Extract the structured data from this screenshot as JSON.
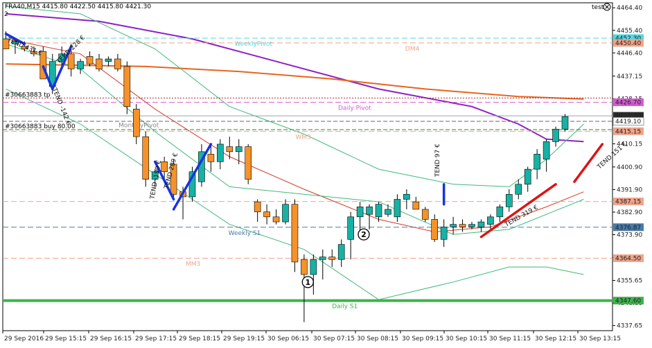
{
  "header": {
    "symbol": "FRA40,M15  4415.80 4422.50 4415.80 4421.30",
    "indicator": "test",
    "corner_digit": "2"
  },
  "colors": {
    "bull": "#17b2a4",
    "bear": "#f5922a",
    "purple": "#8e1fc4",
    "orange": "#e8641e",
    "red": "#d43a2a",
    "green": "#3fb97a",
    "s1": "#3cb44b",
    "cyan": "#4fd8e6",
    "magenta": "#d65ad6",
    "trade": "#b02727",
    "blue_line": "#1733e0",
    "red_line": "#e01212",
    "salmon": "#f0a48a",
    "slate": "#4a7aa8"
  },
  "chart_data": {
    "type": "candlestick",
    "x_ticks": [
      "29 Sep 2016",
      "29 Sep 15:15",
      "29 Sep 16:15",
      "29 Sep 17:15",
      "29 Sep 18:15",
      "29 Sep 19:15",
      "30 Sep 06:15",
      "30 Sep 07:15",
      "30 Sep 08:15",
      "30 Sep 09:15",
      "30 Sep 10:15",
      "30 Sep 11:15",
      "30 Sep 12:15",
      "30 Sep 13:15"
    ],
    "y_ticks": [
      4464.4,
      4455.4,
      4446.4,
      4437.15,
      4428.15,
      4419.1,
      4410.15,
      4400.9,
      4391.9,
      4382.9,
      4373.9,
      4364.65,
      4355.65,
      4346.6,
      4337.65
    ],
    "ylim": [
      4335.6,
      4466.4
    ],
    "candles": [
      {
        "o": 4452,
        "h": 4455,
        "l": 4448,
        "c": 4448
      },
      {
        "o": 4450,
        "h": 4452,
        "l": 4446,
        "c": 4451
      },
      {
        "o": 4449,
        "h": 4451,
        "l": 4447,
        "c": 4448
      },
      {
        "o": 4447,
        "h": 4449,
        "l": 4445,
        "c": 4446
      },
      {
        "o": 4447,
        "h": 4449,
        "l": 4436,
        "c": 4436
      },
      {
        "o": 4433,
        "h": 4446,
        "l": 4430,
        "c": 4443
      },
      {
        "o": 4443,
        "h": 4449,
        "l": 4440,
        "c": 4446
      },
      {
        "o": 4446,
        "h": 4450,
        "l": 4437,
        "c": 4440
      },
      {
        "o": 4440,
        "h": 4444,
        "l": 4438,
        "c": 4443
      },
      {
        "o": 4445,
        "h": 4447,
        "l": 4441,
        "c": 4442
      },
      {
        "o": 4444,
        "h": 4446,
        "l": 4439,
        "c": 4440
      },
      {
        "o": 4443,
        "h": 4445,
        "l": 4441,
        "c": 4444
      },
      {
        "o": 4444,
        "h": 4446,
        "l": 4439,
        "c": 4440
      },
      {
        "o": 4441,
        "h": 4443,
        "l": 4422,
        "c": 4425
      },
      {
        "o": 4424,
        "h": 4426,
        "l": 4410,
        "c": 4413
      },
      {
        "o": 4413,
        "h": 4415,
        "l": 4393,
        "c": 4396
      },
      {
        "o": 4396,
        "h": 4400,
        "l": 4393,
        "c": 4399
      },
      {
        "o": 4403,
        "h": 4405,
        "l": 4396,
        "c": 4399
      },
      {
        "o": 4402,
        "h": 4404,
        "l": 4388,
        "c": 4390
      },
      {
        "o": 4391,
        "h": 4393,
        "l": 4380,
        "c": 4389
      },
      {
        "o": 4389,
        "h": 4401,
        "l": 4387,
        "c": 4399
      },
      {
        "o": 4395,
        "h": 4410,
        "l": 4393,
        "c": 4407
      },
      {
        "o": 4406,
        "h": 4410,
        "l": 4399,
        "c": 4403
      },
      {
        "o": 4403,
        "h": 4412,
        "l": 4400,
        "c": 4410
      },
      {
        "o": 4409,
        "h": 4413,
        "l": 4404,
        "c": 4407
      },
      {
        "o": 4407,
        "h": 4412,
        "l": 4402,
        "c": 4409
      },
      {
        "o": 4409,
        "h": 4410,
        "l": 4394,
        "c": 4396
      },
      {
        "o": 4387,
        "h": 4388,
        "l": 4379,
        "c": 4383
      },
      {
        "o": 4383,
        "h": 4386,
        "l": 4378,
        "c": 4381
      },
      {
        "o": 4381,
        "h": 4384,
        "l": 4378,
        "c": 4379
      },
      {
        "o": 4379,
        "h": 4388,
        "l": 4378,
        "c": 4386
      },
      {
        "o": 4386,
        "h": 4388,
        "l": 4359,
        "c": 4363
      },
      {
        "o": 4364,
        "h": 4366,
        "l": 4339,
        "c": 4358
      },
      {
        "o": 4358,
        "h": 4366,
        "l": 4350,
        "c": 4364
      },
      {
        "o": 4364,
        "h": 4368,
        "l": 4356,
        "c": 4365
      },
      {
        "o": 4365,
        "h": 4368,
        "l": 4361,
        "c": 4364
      },
      {
        "o": 4364,
        "h": 4372,
        "l": 4361,
        "c": 4370
      },
      {
        "o": 4372,
        "h": 4383,
        "l": 4364,
        "c": 4381
      },
      {
        "o": 4381,
        "h": 4387,
        "l": 4375,
        "c": 4385
      },
      {
        "o": 4382,
        "h": 4386,
        "l": 4376,
        "c": 4385
      },
      {
        "o": 4381,
        "h": 4387,
        "l": 4379,
        "c": 4386
      },
      {
        "o": 4382,
        "h": 4386,
        "l": 4381,
        "c": 4384
      },
      {
        "o": 4381,
        "h": 4390,
        "l": 4379,
        "c": 4388
      },
      {
        "o": 4388,
        "h": 4392,
        "l": 4384,
        "c": 4390
      },
      {
        "o": 4387,
        "h": 4389,
        "l": 4384,
        "c": 4384
      },
      {
        "o": 4384,
        "h": 4385,
        "l": 4379,
        "c": 4380
      },
      {
        "o": 4380,
        "h": 4382,
        "l": 4371,
        "c": 4372
      },
      {
        "o": 4372,
        "h": 4380,
        "l": 4369,
        "c": 4377
      },
      {
        "o": 4377,
        "h": 4381,
        "l": 4374,
        "c": 4378
      },
      {
        "o": 4378,
        "h": 4380,
        "l": 4375,
        "c": 4377
      },
      {
        "o": 4377,
        "h": 4379,
        "l": 4376,
        "c": 4378
      },
      {
        "o": 4377,
        "h": 4380,
        "l": 4375,
        "c": 4379
      },
      {
        "o": 4378,
        "h": 4382,
        "l": 4376,
        "c": 4381
      },
      {
        "o": 4381,
        "h": 4386,
        "l": 4379,
        "c": 4385
      },
      {
        "o": 4385,
        "h": 4392,
        "l": 4383,
        "c": 4390
      },
      {
        "o": 4390,
        "h": 4396,
        "l": 4388,
        "c": 4394
      },
      {
        "o": 4394,
        "h": 4401,
        "l": 4391,
        "c": 4400
      },
      {
        "o": 4400,
        "h": 4408,
        "l": 4396,
        "c": 4406
      },
      {
        "o": 4404,
        "h": 4412,
        "l": 4399,
        "c": 4411
      },
      {
        "o": 4411,
        "h": 4417,
        "l": 4409,
        "c": 4416
      },
      {
        "o": 4416,
        "h": 4422,
        "l": 4415,
        "c": 4421
      }
    ],
    "indicator_lines": [
      {
        "name": "purple",
        "color": "#8e1fc4",
        "width": 2,
        "points": [
          [
            0,
            4462
          ],
          [
            10,
            4459
          ],
          [
            20,
            4452
          ],
          [
            30,
            4442
          ],
          [
            40,
            4432
          ],
          [
            50,
            4425
          ],
          [
            55,
            4418
          ],
          [
            58,
            4412
          ],
          [
            62,
            4411
          ]
        ]
      },
      {
        "name": "orange",
        "color": "#e8641e",
        "width": 2,
        "points": [
          [
            0,
            4442
          ],
          [
            15,
            4441
          ],
          [
            25,
            4439
          ],
          [
            35,
            4436
          ],
          [
            45,
            4432
          ],
          [
            55,
            4429
          ],
          [
            62,
            4428
          ]
        ]
      },
      {
        "name": "red",
        "color": "#d43a2a",
        "width": 1,
        "points": [
          [
            0,
            4452
          ],
          [
            8,
            4446
          ],
          [
            16,
            4424
          ],
          [
            24,
            4405
          ],
          [
            32,
            4392
          ],
          [
            40,
            4380
          ],
          [
            46,
            4375
          ],
          [
            52,
            4377
          ],
          [
            58,
            4385
          ],
          [
            62,
            4391
          ]
        ]
      },
      {
        "name": "green-upper",
        "color": "#3fb97a",
        "width": 1,
        "points": [
          [
            0,
            4465
          ],
          [
            8,
            4462
          ],
          [
            16,
            4448
          ],
          [
            24,
            4425
          ],
          [
            32,
            4414
          ],
          [
            40,
            4400
          ],
          [
            48,
            4394
          ],
          [
            54,
            4393
          ],
          [
            58,
            4404
          ],
          [
            62,
            4418
          ]
        ]
      },
      {
        "name": "green-mid",
        "color": "#3fb97a",
        "width": 1,
        "points": [
          [
            0,
            4450
          ],
          [
            8,
            4440
          ],
          [
            16,
            4415
          ],
          [
            24,
            4393
          ],
          [
            32,
            4390
          ],
          [
            40,
            4387
          ],
          [
            48,
            4374
          ],
          [
            54,
            4376
          ],
          [
            58,
            4382
          ],
          [
            62,
            4388
          ]
        ]
      },
      {
        "name": "green-lower",
        "color": "#3fb97a",
        "width": 1,
        "points": [
          [
            0,
            4432
          ],
          [
            8,
            4418
          ],
          [
            16,
            4398
          ],
          [
            24,
            4378
          ],
          [
            32,
            4368
          ],
          [
            40,
            4348
          ],
          [
            48,
            4355
          ],
          [
            54,
            4361
          ],
          [
            58,
            4361
          ],
          [
            62,
            4358
          ]
        ]
      }
    ],
    "levels": [
      {
        "value": 4452.3,
        "label": "WeeklyPivot",
        "tag": "4452.30",
        "color": "#4fd8e6",
        "tagBg": "#4fd8e6",
        "dash": "8,4",
        "labelAt": 0.38
      },
      {
        "value": 4450.4,
        "label": "DM4",
        "tag": "4450.40",
        "color": "#f0a48a",
        "tagBg": "#f0a48a",
        "dash": "8,4",
        "labelAt": 0.66
      },
      {
        "value": 4426.7,
        "label": "Daily Pivot",
        "tag": "4426.70",
        "color": "#d65ad6",
        "tagBg": "#d65ad6",
        "dash": "8,4",
        "labelAt": 0.55
      },
      {
        "value": 4421.3,
        "label": "",
        "tag": "4421.30",
        "color": "#9aa5ad",
        "tagBg": "#2b2b2b",
        "dash": "",
        "labelAt": 0
      },
      {
        "value": 4419.1,
        "label": "",
        "tag": "4419.10",
        "color": "#666666",
        "tagBg": "#ffffff",
        "dash": "6,3",
        "labelAt": 0
      },
      {
        "value": 4415.15,
        "label": "WM3",
        "tag": "4415.15",
        "color": "#f0a48a",
        "tagBg": "#f0a48a",
        "dash": "8,4",
        "labelAt": 0.48
      },
      {
        "value": 4387.15,
        "label": "",
        "tag": "4387.15",
        "color": "#f0a48a",
        "tagBg": "#f0a48a",
        "dash": "8,4",
        "labelAt": 0
      },
      {
        "value": 4376.87,
        "label": "Weekly S1",
        "tag": "4376.87",
        "color": "#4a7aa8",
        "tagBg": "#4a7aa8",
        "dash": "8,4",
        "labelAt": 0.37
      },
      {
        "value": 4364.5,
        "label": "MM3",
        "tag": "4364.50",
        "color": "#f0a48a",
        "tagBg": "#f0a48a",
        "dash": "8,4",
        "labelAt": 0.3
      },
      {
        "value": 4347.6,
        "label": "Daily S1",
        "tag": "4347.60",
        "color": "#3cb44b",
        "tagBg": "#3cb44b",
        "dash": "",
        "labelAt": 0.54,
        "width": 4
      }
    ],
    "extra_labels": [
      {
        "text": "MonthlyPivot",
        "value": 4417.6,
        "atX": 0.19,
        "color": "#888888"
      }
    ],
    "trade_lines": [
      {
        "value": 4428.4,
        "label": "#30663883 tp",
        "color": "#b02727",
        "dash": "2,2"
      },
      {
        "value": 4415.8,
        "label": "#30663883 buy 80.00",
        "color": "#2e8b2e",
        "dash": "6,3"
      }
    ],
    "trend_lines": [
      {
        "color": "#1733e0",
        "x1": 0,
        "y1": 4454,
        "x2": 2,
        "y2": 4450
      },
      {
        "color": "#1733e0",
        "x1": 4,
        "y1": 4441,
        "x2": 5,
        "y2": 4432
      },
      {
        "color": "#1733e0",
        "x1": 5,
        "y1": 4432,
        "x2": 7,
        "y2": 4449
      },
      {
        "color": "#1733e0",
        "x1": 16,
        "y1": 4403,
        "x2": 18,
        "y2": 4388
      },
      {
        "color": "#1733e0",
        "x1": 18,
        "y1": 4384,
        "x2": 22,
        "y2": 4410
      },
      {
        "color": "#1733e0",
        "x1": 47,
        "y1": 4394,
        "x2": 47,
        "y2": 4386
      },
      {
        "color": "#e01212",
        "x1": 51,
        "y1": 4373,
        "x2": 59,
        "y2": 4394
      },
      {
        "color": "#e01212",
        "x1": 61,
        "y1": 4395,
        "x2": 64,
        "y2": 4410
      }
    ],
    "annotations": [
      {
        "text": "TEND 431 €",
        "x": 0.1,
        "value": 4451,
        "rotate": 22
      },
      {
        "text": "TEND 228 €",
        "x": 5.7,
        "value": 4442,
        "rotate": -45
      },
      {
        "text": "TEND -142 €",
        "x": 5,
        "value": 4432,
        "rotate": 68
      },
      {
        "text": "TEND 289 €",
        "x": 17.4,
        "value": 4392,
        "rotate": -75
      },
      {
        "text": "TEND -190 €",
        "x": 15.9,
        "value": 4388,
        "rotate": -80
      },
      {
        "text": "TEND 97 €",
        "x": 46.5,
        "value": 4397,
        "rotate": -90
      },
      {
        "text": "TEND 319 €",
        "x": 53.7,
        "value": 4377,
        "rotate": -30
      },
      {
        "text": "TEND 151 €",
        "x": 63.7,
        "value": 4400,
        "rotate": -42
      }
    ],
    "markers": [
      {
        "text": "1",
        "x": 32.4,
        "value": 4355
      },
      {
        "text": "2",
        "x": 38.4,
        "value": 4374
      }
    ]
  }
}
